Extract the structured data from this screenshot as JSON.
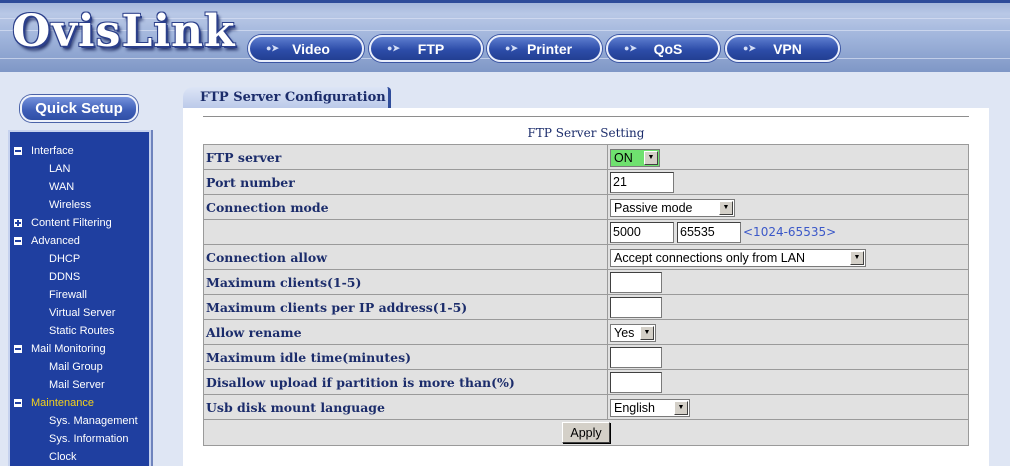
{
  "brand": {
    "logo_text": "OvisLink"
  },
  "nav": {
    "buttons": [
      {
        "label": "Video"
      },
      {
        "label": "FTP"
      },
      {
        "label": "Printer"
      },
      {
        "label": "QoS"
      },
      {
        "label": "VPN"
      }
    ]
  },
  "sidebar": {
    "quick_setup_label": "Quick Setup",
    "menu": [
      {
        "label": "Interface",
        "type": "group",
        "expanded": true
      },
      {
        "label": "LAN",
        "type": "item"
      },
      {
        "label": "WAN",
        "type": "item"
      },
      {
        "label": "Wireless",
        "type": "item"
      },
      {
        "label": "Content Filtering",
        "type": "group",
        "expanded": false
      },
      {
        "label": "Advanced",
        "type": "group",
        "expanded": true
      },
      {
        "label": "DHCP",
        "type": "item"
      },
      {
        "label": "DDNS",
        "type": "item"
      },
      {
        "label": "Firewall",
        "type": "item"
      },
      {
        "label": "Virtual Server",
        "type": "item"
      },
      {
        "label": "Static Routes",
        "type": "item"
      },
      {
        "label": "Mail Monitoring",
        "type": "group",
        "expanded": true
      },
      {
        "label": "Mail Group",
        "type": "item"
      },
      {
        "label": "Mail Server",
        "type": "item"
      },
      {
        "label": "Maintenance",
        "type": "group",
        "expanded": true,
        "active": true
      },
      {
        "label": "Sys. Management",
        "type": "item"
      },
      {
        "label": "Sys. Information",
        "type": "item"
      },
      {
        "label": "Clock",
        "type": "item"
      }
    ]
  },
  "page": {
    "tab_title": "FTP Server Configuration",
    "section_title": "FTP Server Setting"
  },
  "form": {
    "ftp_server": {
      "label": "FTP server",
      "value": "ON",
      "highlight_color": "#6fe16f"
    },
    "port_number": {
      "label": "Port number",
      "value": "21"
    },
    "connection_mode": {
      "label": "Connection mode",
      "value": "Passive mode"
    },
    "passive_range": {
      "start": "5000",
      "end": "65535",
      "hint": "<1024-65535>"
    },
    "connection_allow": {
      "label": "Connection allow",
      "value": "Accept connections only from LAN"
    },
    "max_clients": {
      "label": "Maximum clients(1-5)",
      "value": ""
    },
    "max_clients_per_ip": {
      "label": "Maximum clients per IP address(1-5)",
      "value": ""
    },
    "allow_rename": {
      "label": "Allow rename",
      "value": "Yes"
    },
    "max_idle_time": {
      "label": "Maximum idle time(minutes)",
      "value": ""
    },
    "disallow_upload": {
      "label": "Disallow upload if partition is more than(%)",
      "value": ""
    },
    "usb_language": {
      "label": "Usb disk mount language",
      "value": "English"
    },
    "apply_label": "Apply"
  },
  "colors": {
    "menu_background": "#1f3fa0",
    "menu_active_text": "#f4d21c",
    "label_text": "#1b2c6b",
    "hint_text": "#3b58c8"
  }
}
